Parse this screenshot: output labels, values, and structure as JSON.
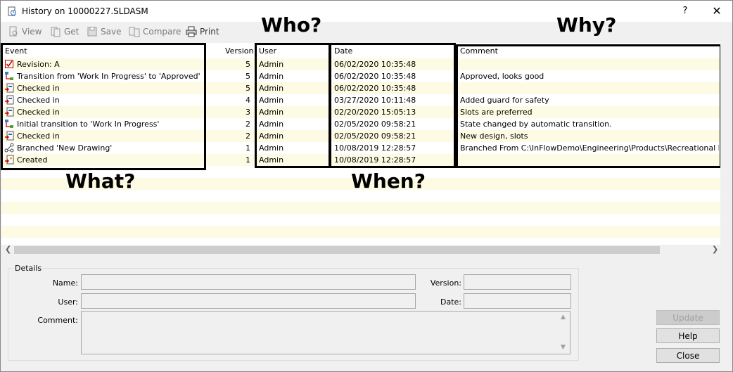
{
  "window": {
    "title": "History on 10000227.SLDASM",
    "help": "?",
    "close": "✕"
  },
  "toolbar": {
    "view": "View",
    "get": "Get",
    "save": "Save",
    "compare": "Compare",
    "print": "Print"
  },
  "annotations": {
    "who": "Who?",
    "why": "Why?",
    "what": "What?",
    "when": "When?"
  },
  "columns": {
    "event": "Event",
    "version": "Version",
    "user": "User",
    "date": "Date",
    "comment": "Comment"
  },
  "rows": [
    {
      "icon": "revision-icon",
      "event": "Revision: A",
      "version": "5",
      "user": "Admin",
      "date": "06/02/2020 10:35:48",
      "comment": ""
    },
    {
      "icon": "transition-icon",
      "event": "Transition from 'Work In Progress' to 'Approved'",
      "version": "5",
      "user": "Admin",
      "date": "06/02/2020 10:35:48",
      "comment": "Approved, looks good"
    },
    {
      "icon": "checked-in-icon",
      "event": "Checked in",
      "version": "5",
      "user": "Admin",
      "date": "06/02/2020 10:35:48",
      "comment": ""
    },
    {
      "icon": "checked-in-icon",
      "event": "Checked in",
      "version": "4",
      "user": "Admin",
      "date": "03/27/2020 10:11:48",
      "comment": "Added guard for safety"
    },
    {
      "icon": "checked-in-icon",
      "event": "Checked in",
      "version": "3",
      "user": "Admin",
      "date": "02/20/2020 15:05:13",
      "comment": "Slots are preferred"
    },
    {
      "icon": "transition-icon",
      "event": "Initial transition to 'Work In Progress'",
      "version": "2",
      "user": "Admin",
      "date": "02/05/2020 09:58:21",
      "comment": "State changed by automatic transition."
    },
    {
      "icon": "checked-in-icon",
      "event": "Checked in",
      "version": "2",
      "user": "Admin",
      "date": "02/05/2020 09:58:21",
      "comment": "New design, slots"
    },
    {
      "icon": "branch-icon",
      "event": "Branched 'New Drawing'",
      "version": "1",
      "user": "Admin",
      "date": "10/08/2019 12:28:57",
      "comment": "Branched From C:\\InFlowDemo\\Engineering\\Products\\Recreational Equipmen"
    },
    {
      "icon": "created-icon",
      "event": "Created",
      "version": "1",
      "user": "Admin",
      "date": "10/08/2019 12:28:57",
      "comment": ""
    }
  ],
  "details": {
    "legend": "Details",
    "name_label": "Name:",
    "user_label": "User:",
    "comment_label": "Comment:",
    "version_label": "Version:",
    "date_label": "Date:"
  },
  "buttons": {
    "update": "Update",
    "help": "Help",
    "close": "Close"
  },
  "colors": {
    "stripe": "#fdfbe3",
    "border": "#000000"
  }
}
